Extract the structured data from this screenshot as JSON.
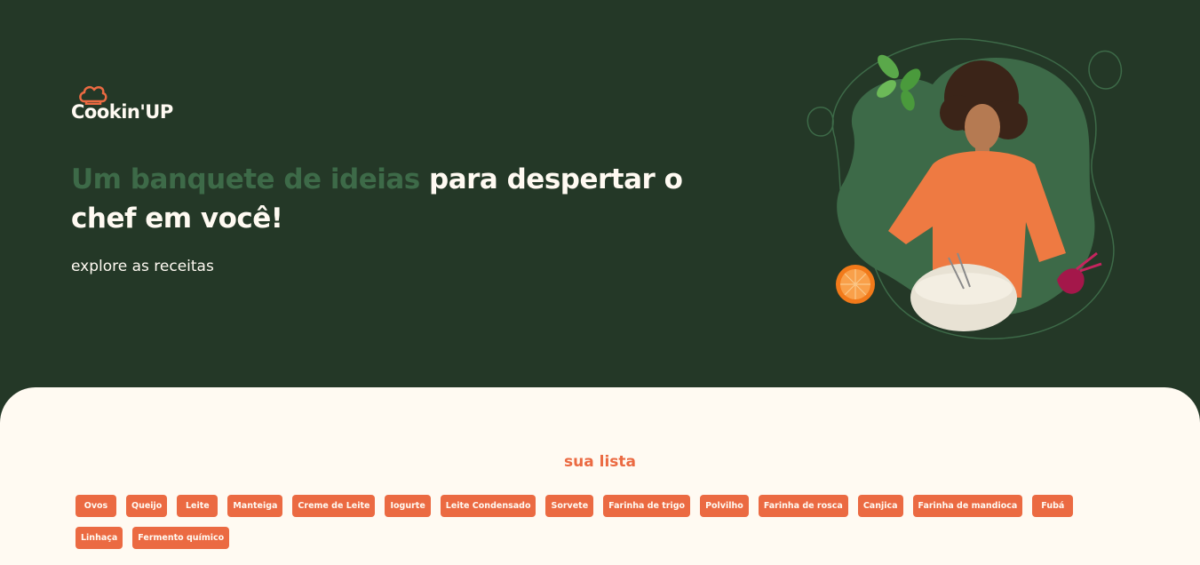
{
  "brand": {
    "logo_text": "Cookin'UP"
  },
  "hero": {
    "headline_accent": "Um banquete de ideias",
    "headline_rest": " para despertar o chef em você!",
    "subtitle": "explore as receitas"
  },
  "list": {
    "title": "sua lista",
    "items": [
      "Ovos",
      "Queijo",
      "Leite",
      "Manteiga",
      "Creme de Leite",
      "Iogurte",
      "Leite Condensado",
      "Sorvete",
      "Farinha de trigo",
      "Polvilho",
      "Farinha de rosca",
      "Canjica",
      "Farinha de mandioca",
      "Fubá",
      "Linhaça",
      "Fermento químico"
    ]
  },
  "colors": {
    "background_dark": "#243827",
    "accent_green": "#3d6a48",
    "accent_orange": "#eb6a42",
    "cream": "#fffaf2"
  }
}
